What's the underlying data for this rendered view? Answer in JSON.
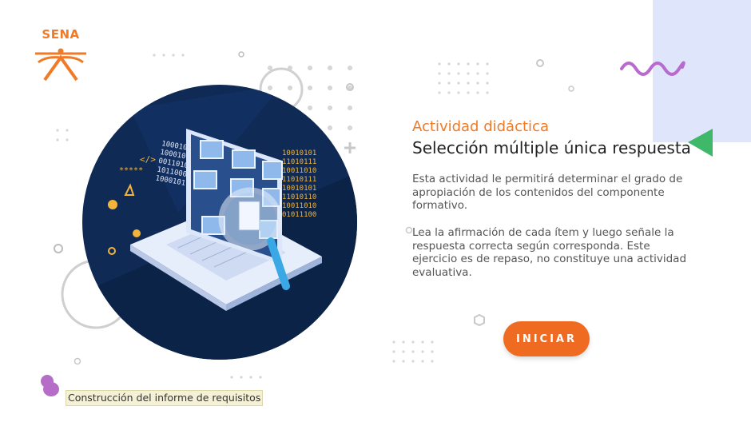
{
  "brand": {
    "logo_text": "SENA"
  },
  "activity": {
    "category": "Actividad didáctica",
    "title": "Selección múltiple única respuesta",
    "description": "Esta actividad le permitirá determinar el grado de apropiación de los contenidos del componente formativo.",
    "instructions": "Lea la afirmación de cada ítem y luego señale la respuesta correcta según corresponda.  Este ejercicio es de repaso, no constituye una actividad evaluativa."
  },
  "actions": {
    "start_label": "INICIAR"
  },
  "footer": {
    "course_label": "Construcción del informe de requisitos"
  },
  "colors": {
    "accent": "#f06b22",
    "panel": "#dfe6fb",
    "wave": "#b96ad0",
    "triangle": "#3fb86a",
    "hero": "#0f2a55"
  }
}
